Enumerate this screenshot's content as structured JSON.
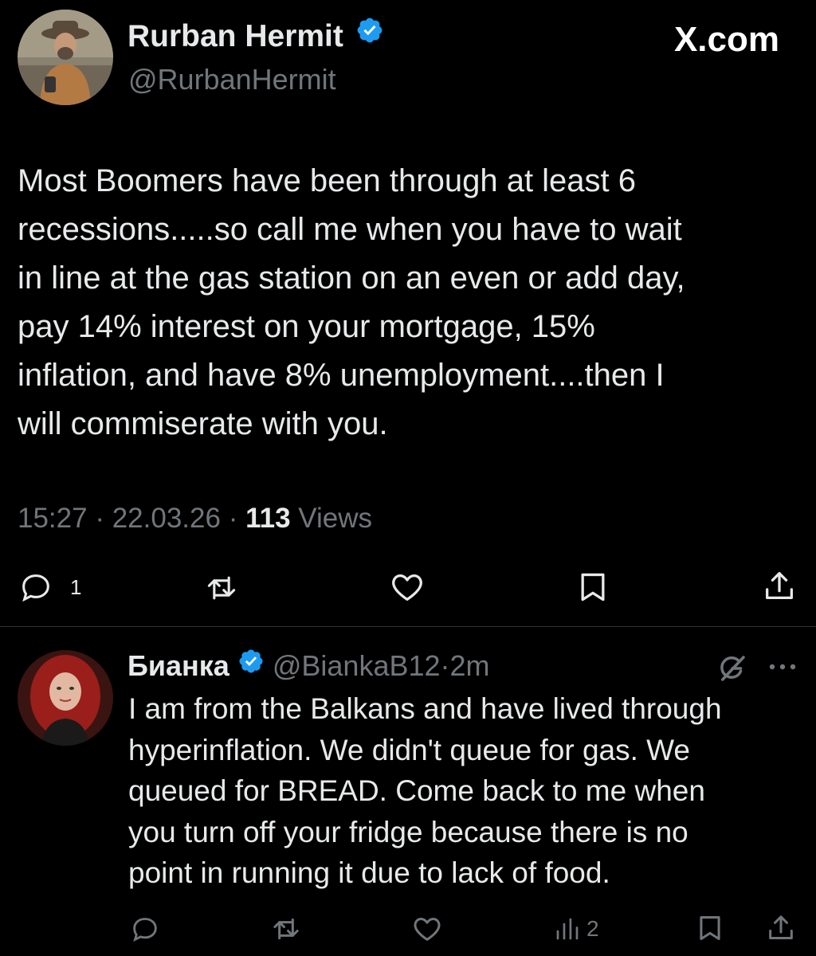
{
  "main_tweet": {
    "author_name": "Rurban Hermit",
    "handle": "@RurbanHermit",
    "watermark": "X.com",
    "text": "Most Boomers have been through at least 6\nrecessions.....so call me when you have to wait\nin line at the gas station on an even or add day,\npay 14% interest on your mortgage, 15%\ninflation, and have 8% unemployment....then I\nwill commiserate with you.",
    "time": "15:27",
    "date": "22.03.26",
    "views_count": "113",
    "views_label": "Views",
    "meta_sep": "·",
    "reply_count": "1"
  },
  "reply_tweet": {
    "author_name": "Бианка",
    "handle": "@BiankaB12",
    "age": "2m",
    "sep": "·",
    "text": "I am from the Balkans and have lived through\nhyperinflation. We didn't queue for gas. We\nqueued for BREAD. Come back to me when\nyou turn off your fridge because there is no\npoint in running it due to lack of food.",
    "views_count": "2"
  },
  "colors": {
    "verified": "#1d9bf0",
    "muted": "#71767b",
    "text": "#e7e9ea",
    "background": "#000000"
  },
  "icons": [
    "reply-icon",
    "retweet-icon",
    "like-icon",
    "bookmark-icon",
    "share-icon",
    "analytics-icon",
    "grok-icon",
    "more-icon",
    "verified-badge-icon"
  ]
}
